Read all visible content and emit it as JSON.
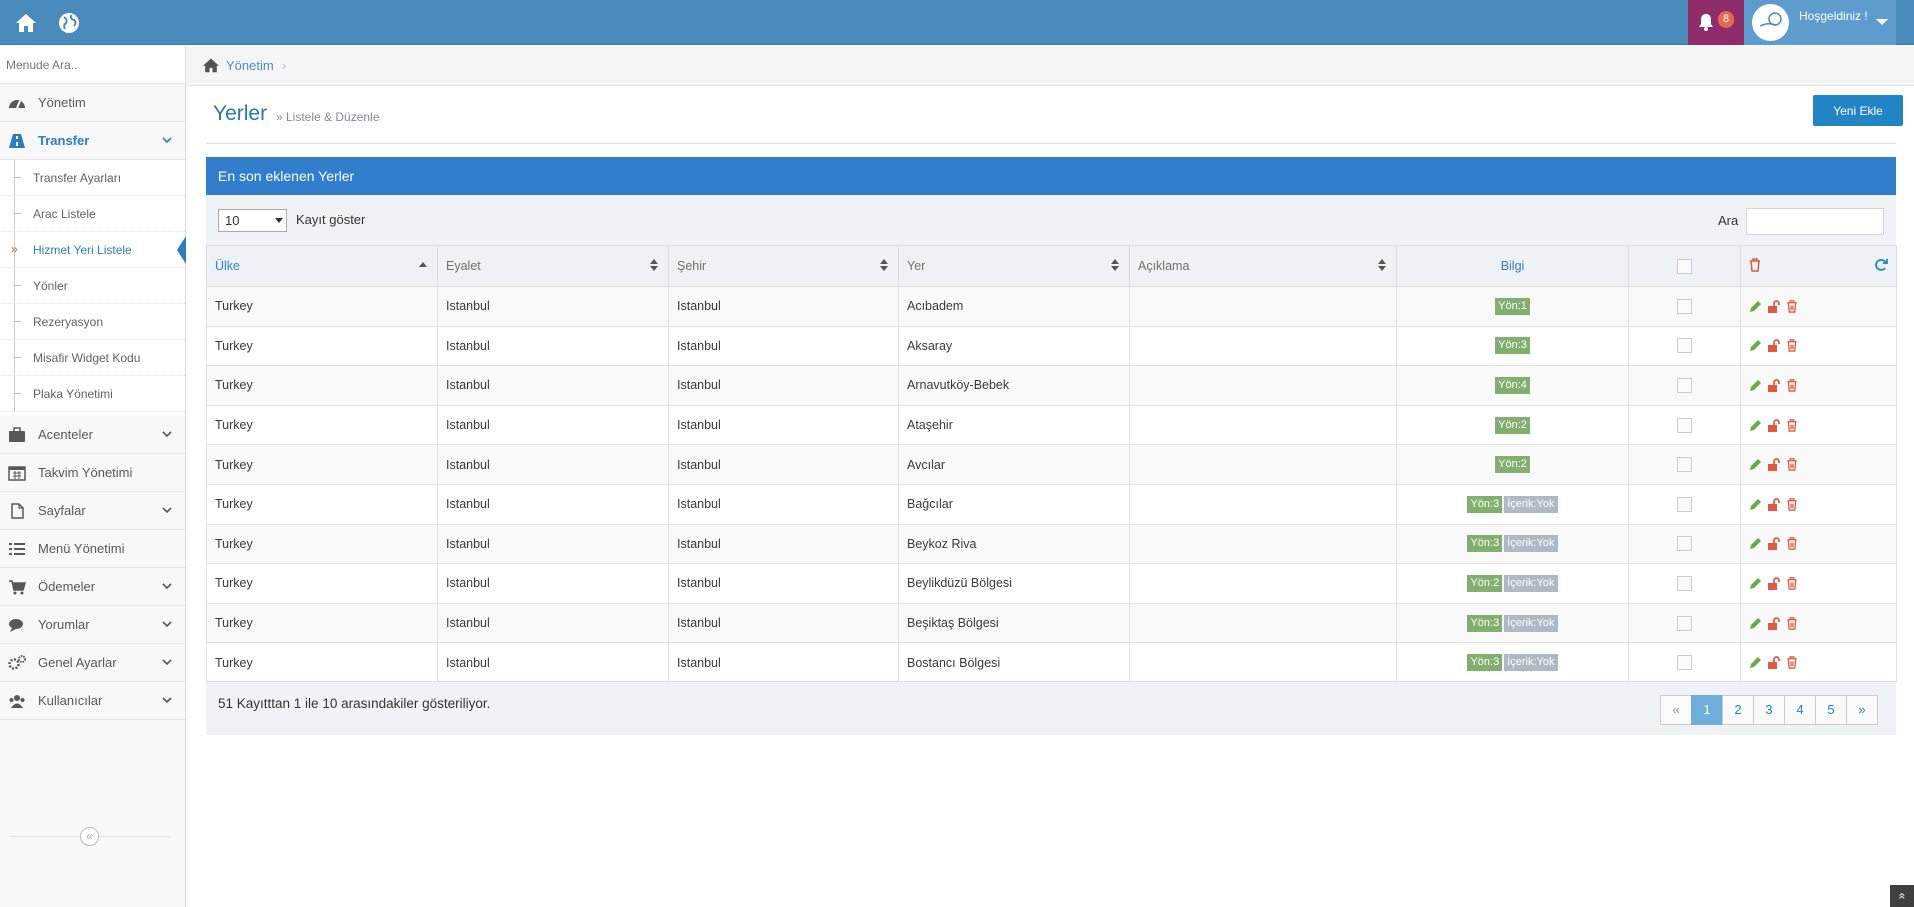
{
  "topbar": {
    "notification_count": "8",
    "welcome": "Hoşgeldiniz !"
  },
  "sidebar": {
    "search_placeholder": "Menude Ara..",
    "items": [
      {
        "label": "Yönetim",
        "icon": "dashboard-icon"
      },
      {
        "label": "Transfer",
        "icon": "road-icon"
      },
      {
        "label": "Acenteler",
        "icon": "briefcase-icon"
      },
      {
        "label": "Takvim Yönetimi",
        "icon": "calendar-icon"
      },
      {
        "label": "Sayfalar",
        "icon": "file-icon"
      },
      {
        "label": "Menü Yönetimi",
        "icon": "list-icon"
      },
      {
        "label": "Ödemeler",
        "icon": "cart-icon"
      },
      {
        "label": "Yorumlar",
        "icon": "comments-icon"
      },
      {
        "label": "Genel Ayarlar",
        "icon": "cogs-icon"
      },
      {
        "label": "Kullanıcılar",
        "icon": "users-icon"
      }
    ],
    "submenu": [
      {
        "label": "Transfer Ayarları"
      },
      {
        "label": "Arac Listele"
      },
      {
        "label": "Hizmet Yeri Listele"
      },
      {
        "label": "Yönler"
      },
      {
        "label": "Rezeryasyon"
      },
      {
        "label": "Misafir Widget Kodu"
      },
      {
        "label": "Plaka Yönetimi"
      }
    ],
    "collapse_glyph": "«"
  },
  "breadcrumb": {
    "home": "Yönetim",
    "sep": "›"
  },
  "page": {
    "title": "Yerler",
    "subtitle": "» Listele & Düzenle",
    "new_button": "Yeni Ekle"
  },
  "widget": {
    "title": "En son eklenen Yerler",
    "length_value": "10",
    "length_label": "Kayıt göster",
    "search_label": "Ara"
  },
  "table": {
    "headers": [
      "Ülke",
      "Eyalet",
      "Şehir",
      "Yer",
      "Açıklama",
      "Bilgi"
    ],
    "rows": [
      {
        "ulke": "Turkey",
        "eyalet": "Istanbul",
        "sehir": "Istanbul",
        "yer": "Acıbadem",
        "aciklama": "",
        "yon": "Yön:1",
        "icerik": ""
      },
      {
        "ulke": "Turkey",
        "eyalet": "Istanbul",
        "sehir": "Istanbul",
        "yer": "Aksaray",
        "aciklama": "",
        "yon": "Yön:3",
        "icerik": ""
      },
      {
        "ulke": "Turkey",
        "eyalet": "Istanbul",
        "sehir": "Istanbul",
        "yer": "Arnavutköy-Bebek",
        "aciklama": "",
        "yon": "Yön:4",
        "icerik": ""
      },
      {
        "ulke": "Turkey",
        "eyalet": "Istanbul",
        "sehir": "Istanbul",
        "yer": "Ataşehir",
        "aciklama": "",
        "yon": "Yön:2",
        "icerik": ""
      },
      {
        "ulke": "Turkey",
        "eyalet": "Istanbul",
        "sehir": "Istanbul",
        "yer": "Avcılar",
        "aciklama": "",
        "yon": "Yön:2",
        "icerik": ""
      },
      {
        "ulke": "Turkey",
        "eyalet": "Istanbul",
        "sehir": "Istanbul",
        "yer": "Bağcılar",
        "aciklama": "",
        "yon": "Yön:3",
        "icerik": "İçerik:Yok"
      },
      {
        "ulke": "Turkey",
        "eyalet": "Istanbul",
        "sehir": "Istanbul",
        "yer": "Beykoz Riva",
        "aciklama": "",
        "yon": "Yön:3",
        "icerik": "İçerik:Yok"
      },
      {
        "ulke": "Turkey",
        "eyalet": "Istanbul",
        "sehir": "Istanbul",
        "yer": "Beylikdüzü Bölgesi",
        "aciklama": "",
        "yon": "Yön:2",
        "icerik": "İçerik:Yok"
      },
      {
        "ulke": "Turkey",
        "eyalet": "Istanbul",
        "sehir": "Istanbul",
        "yer": "Beşiktaş Bölgesi",
        "aciklama": "",
        "yon": "Yön:3",
        "icerik": "İçerik:Yok"
      },
      {
        "ulke": "Turkey",
        "eyalet": "Istanbul",
        "sehir": "Istanbul",
        "yer": "Bostancı Bölgesi",
        "aciklama": "",
        "yon": "Yön:3",
        "icerik": "İçerik:Yok"
      }
    ]
  },
  "footer": {
    "info": "51 Kayıtttan 1 ile 10 arasındakiler gösteriliyor.",
    "pages": [
      "«",
      "1",
      "2",
      "3",
      "4",
      "5",
      "»"
    ]
  },
  "scroll_top_glyph": "«",
  "colors": {
    "topbar": "#4a8bbd",
    "accent": "#307ecc",
    "notification_bg": "#8f2d6a",
    "badge_green": "#82af6f",
    "badge_grey": "#abbac3",
    "action_edit": "#69aa46",
    "action_delete": "#dd5a43"
  }
}
